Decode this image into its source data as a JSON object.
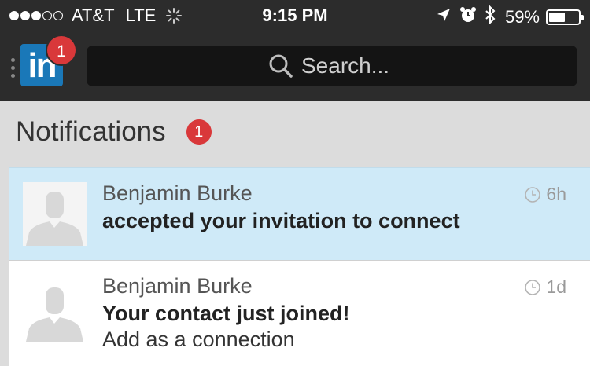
{
  "status_bar": {
    "carrier": "AT&T",
    "network": "LTE",
    "time": "9:15 PM",
    "battery_percent": "59%",
    "battery_level": 0.59,
    "signal_bars": 3,
    "signal_total": 5
  },
  "app": {
    "logo_text": "in",
    "logo_badge_count": "1"
  },
  "search": {
    "placeholder": "Search..."
  },
  "notifications": {
    "title": "Notifications",
    "badge_count": "1",
    "items": [
      {
        "name": "Benjamin Burke",
        "message": "accepted your invitation to connect",
        "subtext": "",
        "age": "6h",
        "unread": true
      },
      {
        "name": "Benjamin Burke",
        "message": "Your contact just joined!",
        "subtext": "Add as a connection",
        "age": "1d",
        "unread": false
      }
    ]
  },
  "colors": {
    "top_bar": "#2c2c2c",
    "brand_blue": "#1a78b8",
    "badge_red": "#d9383a",
    "unread_bg": "#cfeaf8",
    "page_bg": "#dcdcdc"
  },
  "icons": [
    "location-icon",
    "alarm-icon",
    "bluetooth-icon",
    "battery-icon",
    "search-icon",
    "clock-icon",
    "spinner-icon"
  ]
}
